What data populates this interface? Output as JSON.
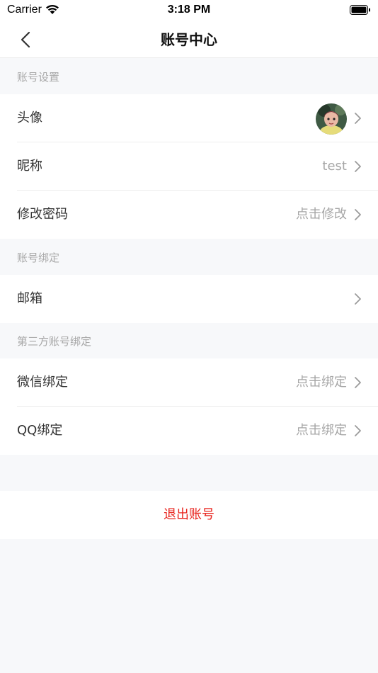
{
  "status_bar": {
    "carrier": "Carrier",
    "time": "3:18 PM"
  },
  "nav": {
    "title": "账号中心",
    "back_icon": "chevron-left-icon"
  },
  "sections": {
    "account_settings": {
      "header": "账号设置",
      "avatar": {
        "label": "头像",
        "value": ""
      },
      "nickname": {
        "label": "昵称",
        "value": "test"
      },
      "password": {
        "label": "修改密码",
        "value": "点击修改"
      }
    },
    "account_binding": {
      "header": "账号绑定",
      "email": {
        "label": "邮箱",
        "value": ""
      }
    },
    "third_party": {
      "header": "第三方账号绑定",
      "wechat": {
        "label": "微信绑定",
        "value": "点击绑定"
      },
      "qq": {
        "label": "QQ绑定",
        "value": "点击绑定"
      }
    }
  },
  "logout": {
    "label": "退出账号"
  },
  "colors": {
    "background": "#f7f8fa",
    "row_background": "#ffffff",
    "secondary_text": "#a6a6a6",
    "danger": "#e8251f"
  }
}
